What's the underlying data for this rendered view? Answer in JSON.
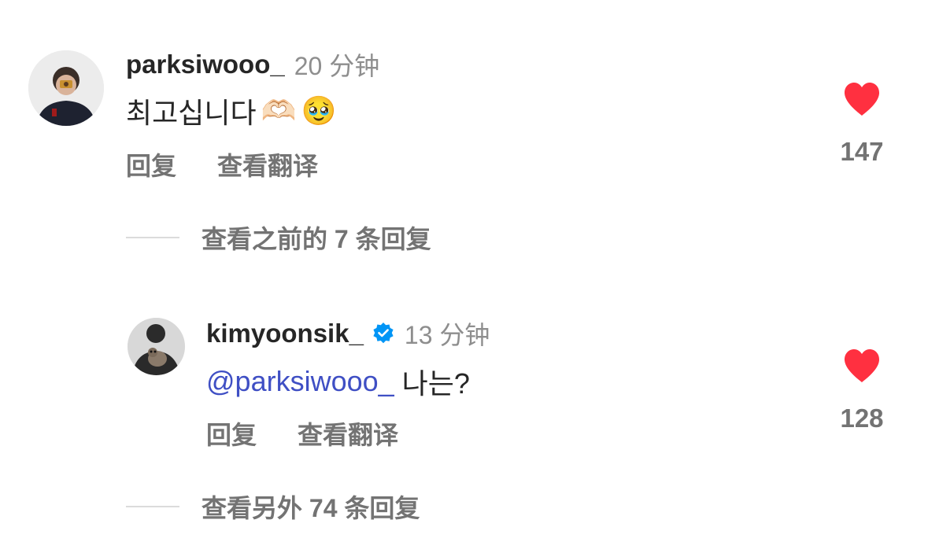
{
  "comments": [
    {
      "username": "parksiwooo_",
      "time": "20 分钟",
      "text": "최고십니다",
      "emojis": [
        "🫶🏻",
        "🥹"
      ],
      "reply_label": "回复",
      "translate_label": "查看翻译",
      "likes": "147",
      "view_replies": "查看之前的 7 条回复"
    },
    {
      "username": "kimyoonsik_",
      "verified": true,
      "time": "13 分钟",
      "mention": "@parksiwooo_",
      "text": " 나는?",
      "reply_label": "回复",
      "translate_label": "查看翻译",
      "likes": "128",
      "view_replies": "查看另外 74 条回复"
    }
  ],
  "colors": {
    "heart": "#ff3040",
    "mention": "#3f4fc4",
    "verified": "#0095f6",
    "muted": "#737373"
  },
  "icons": {
    "like": "heart-filled-icon",
    "verified": "verified-badge-icon"
  }
}
